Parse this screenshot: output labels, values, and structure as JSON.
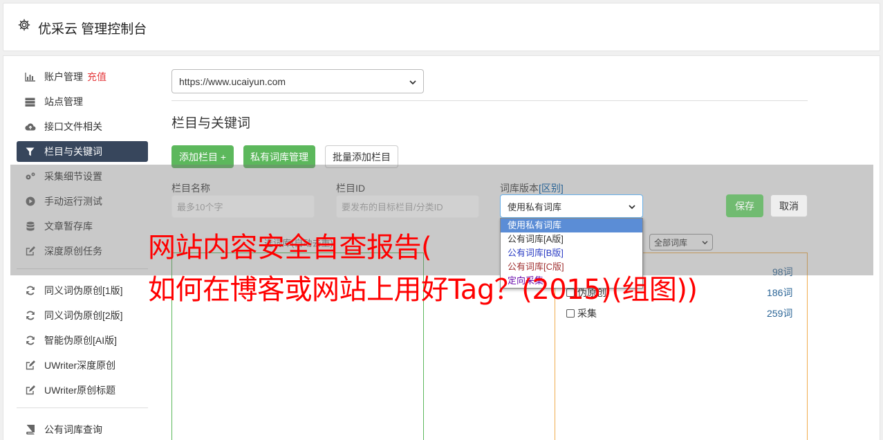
{
  "header": {
    "title": "优采云 管理控制台"
  },
  "sidebar": {
    "items": [
      {
        "label": "账户管理",
        "extra": "充值",
        "icon": "bar-chart-icon"
      },
      {
        "label": "站点管理",
        "icon": "server-icon"
      },
      {
        "label": "接口文件相关",
        "icon": "cloud-upload-icon"
      },
      {
        "label": "栏目与关键词",
        "icon": "filter-icon",
        "active": true
      },
      {
        "label": "采集细节设置",
        "icon": "cogs-icon"
      },
      {
        "label": "手动运行测试",
        "icon": "play-icon"
      },
      {
        "label": "文章暂存库",
        "icon": "database-icon"
      },
      {
        "label": "深度原创任务",
        "icon": "edit-icon"
      }
    ],
    "items2": [
      {
        "label": "同义词伪原创[1版]",
        "icon": "refresh-icon"
      },
      {
        "label": "同义词伪原创[2版]",
        "icon": "refresh-icon"
      },
      {
        "label": "智能伪原创[AI版]",
        "icon": "refresh-icon"
      },
      {
        "label": "UWriter深度原创",
        "icon": "edit-icon"
      },
      {
        "label": "UWriter原创标题",
        "icon": "edit-icon"
      }
    ],
    "items3": [
      {
        "label": "公有词库查询",
        "icon": "book-icon"
      }
    ]
  },
  "main": {
    "site_select": "https://www.ucaiyun.com",
    "section_title": "栏目与关键词",
    "buttons": {
      "add_column": "添加栏目 +",
      "private_lib": "私有词库管理",
      "batch_add": "批量添加栏目"
    },
    "form": {
      "name_label": "栏目名称",
      "name_placeholder": "最多10个字",
      "id_label": "栏目ID",
      "id_placeholder": "要发布的目标栏目/分类ID",
      "version_label": "词库版本",
      "version_diff": "[区别]",
      "version_value": "使用私有词库",
      "save": "保存",
      "cancel": "取消"
    },
    "version_options": [
      "使用私有词库",
      "公有词库[A版]",
      "公有词库[B版]",
      "公有词库[C版]",
      "定向采集"
    ],
    "hint_text": "选词库(自动去重)",
    "lib_filter": "全部词库",
    "word_libs": [
      {
        "name": "",
        "count": "98词"
      },
      {
        "name": "伪原创",
        "count": "186词"
      },
      {
        "name": "采集",
        "count": "259词"
      }
    ]
  },
  "overlay_headline": {
    "line1": "网站内容安全自查报告(",
    "line2": "如何在博客或网站上用好Tag？(2015)(组图))"
  },
  "colors": {
    "active_nav": "#37465c",
    "green": "#5cb85c",
    "red": "#ff0000",
    "link": "#2a6496"
  }
}
